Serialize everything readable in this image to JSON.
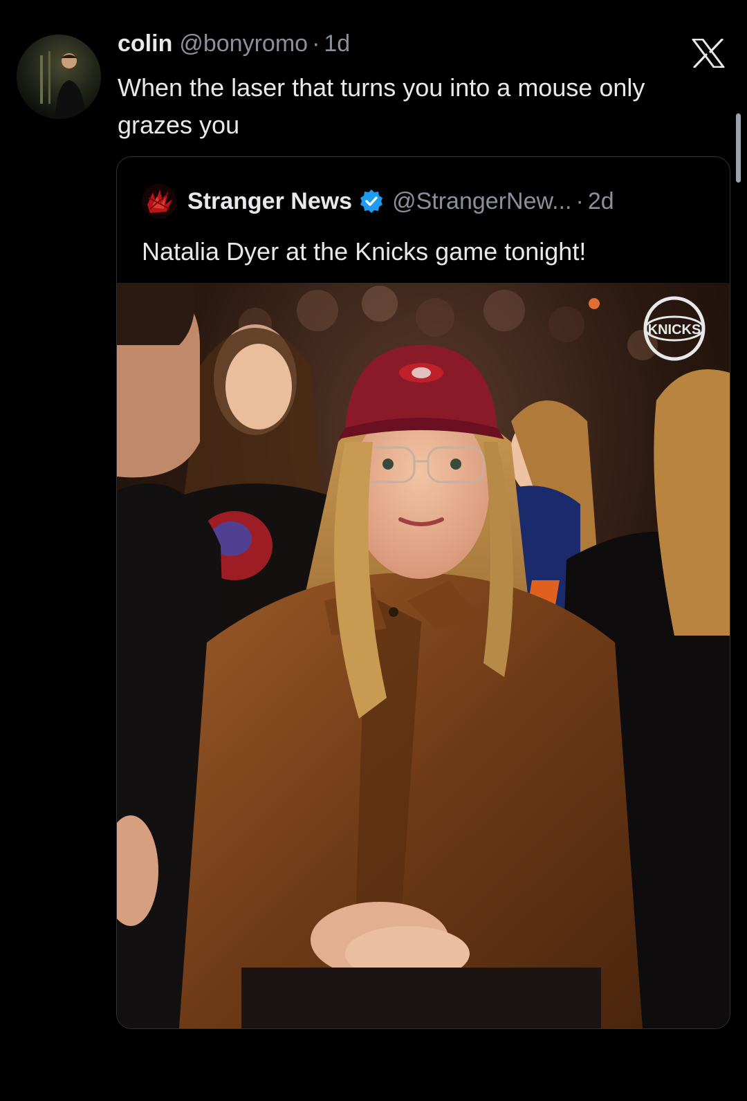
{
  "tweet": {
    "author_name": "colin",
    "author_handle": "@bonyromo",
    "separator": "·",
    "age": "1d",
    "text": "When the laser that turns you into a mouse only grazes you",
    "avatar_icon": "user-avatar"
  },
  "quoted_tweet": {
    "author_name": "Stranger News",
    "author_handle": "@StrangerNew...",
    "separator": "·",
    "age": "2d",
    "text": "Natalia Dyer at the Knicks game tonight!",
    "verified": true,
    "verified_color": "#1d9bf0",
    "avatar_icon": "stranger-news-logo",
    "photo_logo_text": "KNICKS"
  },
  "platform_logo": "x-logo",
  "colors": {
    "background": "#000000",
    "text_primary": "#e7e9ea",
    "text_secondary": "#8b9199",
    "card_border": "#2f3336"
  }
}
